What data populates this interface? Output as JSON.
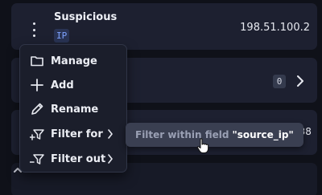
{
  "entity_row": {
    "title": "Suspicious",
    "type_badge": "IP",
    "value": "198.51.100.2"
  },
  "second_row": {
    "count": "0"
  },
  "third_row": {
    "value_fragment": "138"
  },
  "context_menu": {
    "items": [
      {
        "label": "Manage",
        "icon": "folder-icon"
      },
      {
        "label": "Add",
        "icon": "plus-icon"
      },
      {
        "label": "Rename",
        "icon": "pencil-icon"
      },
      {
        "label": "Filter for",
        "icon": "filter-plus-icon",
        "has_submenu": true
      },
      {
        "label": "Filter out",
        "icon": "filter-minus-icon",
        "has_submenu": true
      }
    ],
    "submenu": {
      "prefix": "Filter within field",
      "field": "\"source_ip\""
    }
  },
  "colors": {
    "background": "#0f1119",
    "card": "#1d2030",
    "menu": "#1b1e2b",
    "submenu": "#3a3f51",
    "badge_text": "#7ea3ff"
  }
}
